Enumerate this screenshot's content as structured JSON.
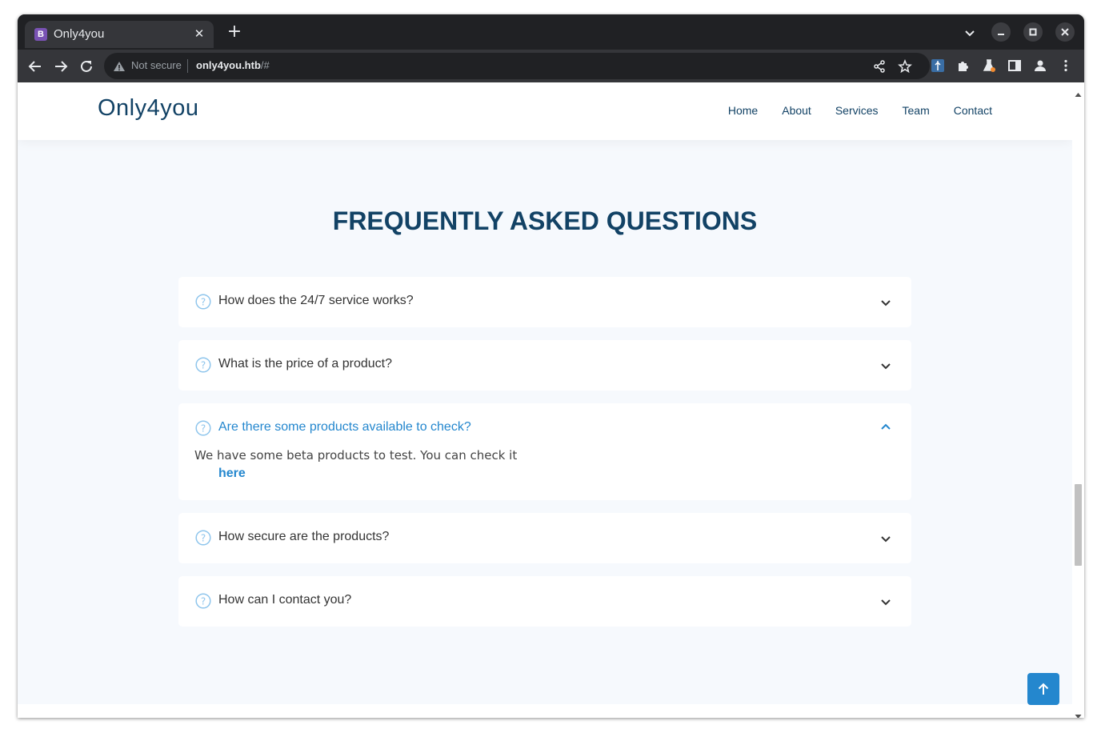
{
  "browser": {
    "tab_title": "Only4you",
    "tab_favicon_letter": "B",
    "tab_favicon_color": "#7952b3",
    "new_tab_label": "+",
    "close_tab_label": "✕",
    "security_label": "Not secure",
    "url_host": "only4you.htb",
    "url_path": "/#"
  },
  "site": {
    "logo": "Only4you",
    "nav": [
      "Home",
      "About",
      "Services",
      "Team",
      "Contact"
    ],
    "accent_color": "#2487ce",
    "heading_color": "#124265"
  },
  "faq": {
    "title": "FREQUENTLY ASKED QUESTIONS",
    "items": [
      {
        "question": "How does the 24/7 service works?",
        "expanded": false
      },
      {
        "question": "What is the price of a product?",
        "expanded": false
      },
      {
        "question": "Are there some products available to check?",
        "expanded": true,
        "answer": "We have some beta products to test. You can check it",
        "link": "here"
      },
      {
        "question": "How secure are the products?",
        "expanded": false
      },
      {
        "question": "How can I contact you?",
        "expanded": false
      }
    ]
  },
  "icons": {
    "faq_icon": "question-circle-icon",
    "collapsed": "chevron-down-icon",
    "expanded": "chevron-up-icon",
    "back_to_top": "arrow-up-icon"
  }
}
